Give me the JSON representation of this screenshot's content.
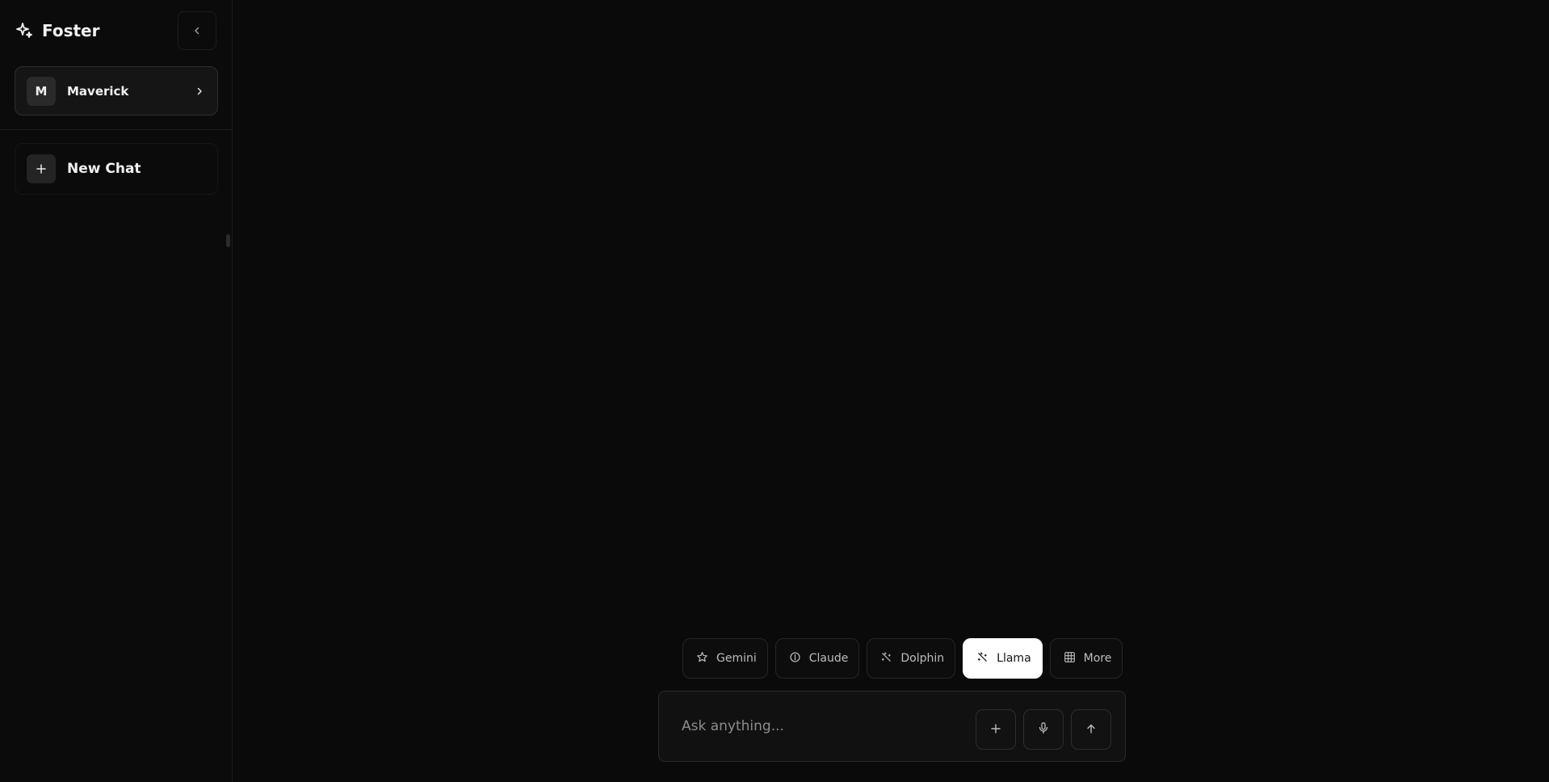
{
  "sidebar": {
    "brand": {
      "name": "Foster",
      "icon": "sparkles-icon"
    },
    "collapse_icon": "chevron-left-icon",
    "profile": {
      "initial": "M",
      "name": "Maverick",
      "chevron_icon": "chevron-right-icon"
    },
    "new_chat": {
      "label": "New Chat",
      "icon": "plus-icon"
    }
  },
  "models": [
    {
      "label": "Gemini",
      "icon": "star-icon",
      "active": false
    },
    {
      "label": "Claude",
      "icon": "circle-line-icon",
      "active": false
    },
    {
      "label": "Dolphin",
      "icon": "sparkles-icon",
      "active": false
    },
    {
      "label": "Llama",
      "icon": "sparkles-icon",
      "active": true
    },
    {
      "label": "More",
      "icon": "grid-icon",
      "active": false
    }
  ],
  "composer": {
    "placeholder": "Ask anything...",
    "value": "",
    "attach_icon": "plus-icon",
    "mic_icon": "microphone-icon",
    "send_icon": "arrow-up-icon"
  },
  "colors": {
    "background": "#0a0a0a",
    "active_chip": "#ffffff",
    "text": "#f0f0f0",
    "muted_text": "#8d8d8d"
  }
}
